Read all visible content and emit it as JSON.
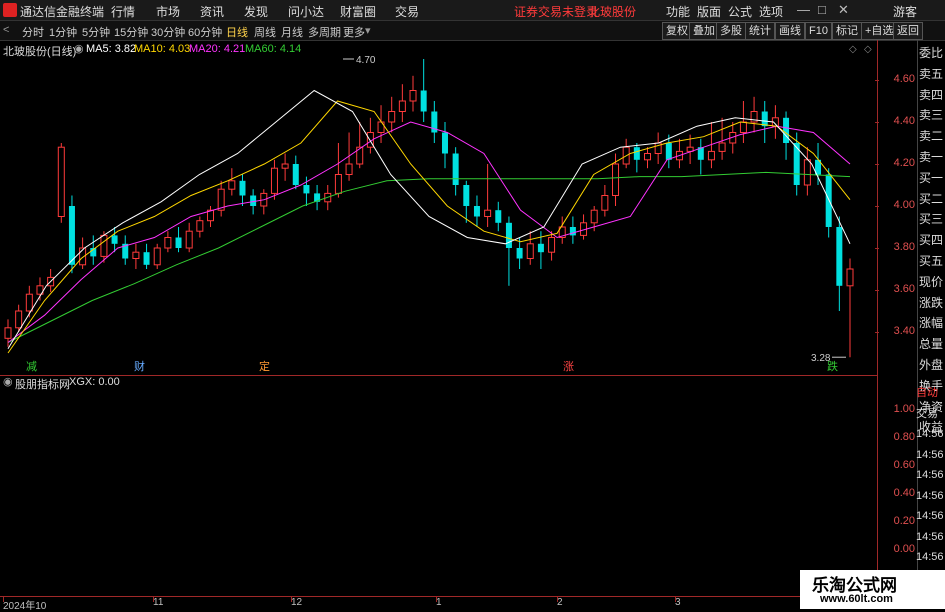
{
  "menubar": {
    "app_title": "通达信金融终端",
    "items": [
      "行情",
      "市场",
      "资讯",
      "发现",
      "问小达",
      "财富圈",
      "交易"
    ],
    "status_unlogged": "证券交易未登录",
    "status_stock": "北玻股份",
    "right_items": [
      "功能",
      "版面",
      "公式",
      "选项"
    ],
    "guest": "游客",
    "win_min": "—",
    "win_max": "□",
    "win_close": "✕"
  },
  "toolbar": {
    "periods": [
      "分时",
      "1分钟",
      "5分钟",
      "15分钟",
      "30分钟",
      "60分钟",
      "日线",
      "周线",
      "月线",
      "多周期",
      "更多"
    ],
    "active_period": "日线",
    "right_buttons": [
      "复权",
      "叠加",
      "多股",
      "统计",
      "画线",
      "F10",
      "标记",
      "+自选",
      "返回"
    ]
  },
  "chart": {
    "title": "北玻股份(日线)",
    "ma5": "MA5: 3.82",
    "ma10": "MA10: 4.03",
    "ma20": "MA20: 4.21",
    "ma60": "MA60: 4.14",
    "high_label": "4.70",
    "low_label": "3.28",
    "markers": [
      {
        "text": "减",
        "color": "#33cc33",
        "x": 31
      },
      {
        "text": "财",
        "color": "#66aaff",
        "x": 139
      },
      {
        "text": "定",
        "color": "#ff9933",
        "x": 264
      },
      {
        "text": "涨",
        "color": "#ff4444",
        "x": 568
      },
      {
        "text": "跌",
        "color": "#33cc33",
        "x": 832
      }
    ],
    "colors": {
      "up": "#ff3b3b",
      "down": "#00e0e0",
      "ma5": "#ffffff",
      "ma10": "#ffd700",
      "ma20": "#ff33ff",
      "ma60": "#33cc33",
      "axis": "#c03030"
    }
  },
  "subchart": {
    "title": "股朋指标网",
    "xgx": "XGX: 0.00"
  },
  "chart_data": {
    "type": "candlestick",
    "y_axis_ticks": [
      "4.60",
      "4.40",
      "4.20",
      "4.00",
      "3.80",
      "3.60",
      "3.40"
    ],
    "sub_axis_ticks": [
      "1.00",
      "0.80",
      "0.60",
      "0.40",
      "0.20",
      "0.00"
    ],
    "x_ticks": [
      "2024年10",
      "11",
      "12",
      "1",
      "2",
      "3"
    ],
    "ylim": [
      3.22,
      4.78
    ],
    "ma60": [
      3.35,
      3.45,
      3.55,
      3.63,
      3.72,
      3.8,
      3.9,
      4.0,
      4.07,
      4.12,
      4.13,
      4.13,
      4.13,
      4.13,
      4.13,
      4.14,
      4.14,
      4.15,
      4.16,
      4.15,
      4.14
    ],
    "ma20": [
      3.35,
      3.48,
      3.65,
      3.8,
      3.85,
      3.95,
      4.0,
      4.03,
      4.1,
      4.2,
      4.32,
      4.4,
      4.35,
      4.25,
      3.98,
      3.85,
      3.9,
      3.95,
      4.22,
      4.28,
      4.34,
      4.38,
      4.35,
      4.2
    ],
    "ma10": [
      3.3,
      3.55,
      3.75,
      3.88,
      3.95,
      4.05,
      4.12,
      4.2,
      4.3,
      4.5,
      4.45,
      4.2,
      4.0,
      3.88,
      3.83,
      3.87,
      4.15,
      4.25,
      4.3,
      4.33,
      4.4,
      4.38,
      4.25,
      4.03
    ],
    "ma5": [
      3.32,
      3.62,
      3.8,
      3.92,
      4.02,
      4.15,
      4.25,
      4.4,
      4.55,
      4.45,
      4.15,
      3.95,
      3.85,
      3.82,
      3.9,
      4.2,
      4.28,
      4.3,
      4.38,
      4.42,
      4.4,
      4.2,
      3.82
    ],
    "candles": [
      [
        3.37,
        3.42,
        3.46,
        3.33
      ],
      [
        3.42,
        3.5,
        3.53,
        3.4
      ],
      [
        3.5,
        3.58,
        3.62,
        3.47
      ],
      [
        3.58,
        3.62,
        3.66,
        3.55
      ],
      [
        3.62,
        3.66,
        3.7,
        3.59
      ],
      [
        3.95,
        4.28,
        4.3,
        3.92
      ],
      [
        4.0,
        3.72,
        4.05,
        3.68
      ],
      [
        3.72,
        3.8,
        3.85,
        3.7
      ],
      [
        3.8,
        3.76,
        3.86,
        3.72
      ],
      [
        3.76,
        3.86,
        3.88,
        3.73
      ],
      [
        3.86,
        3.82,
        3.9,
        3.78
      ],
      [
        3.82,
        3.75,
        3.86,
        3.72
      ],
      [
        3.75,
        3.78,
        3.82,
        3.7
      ],
      [
        3.78,
        3.72,
        3.82,
        3.7
      ],
      [
        3.72,
        3.8,
        3.82,
        3.7
      ],
      [
        3.8,
        3.85,
        3.88,
        3.78
      ],
      [
        3.85,
        3.8,
        3.9,
        3.78
      ],
      [
        3.8,
        3.88,
        3.92,
        3.78
      ],
      [
        3.88,
        3.93,
        3.95,
        3.85
      ],
      [
        3.93,
        3.98,
        4.0,
        3.9
      ],
      [
        3.98,
        4.08,
        4.12,
        3.95
      ],
      [
        4.08,
        4.12,
        4.18,
        4.05
      ],
      [
        4.12,
        4.05,
        4.15,
        4.0
      ],
      [
        4.05,
        4.0,
        4.08,
        3.96
      ],
      [
        4.0,
        4.06,
        4.08,
        3.96
      ],
      [
        4.06,
        4.18,
        4.22,
        4.03
      ],
      [
        4.18,
        4.2,
        4.25,
        4.12
      ],
      [
        4.2,
        4.1,
        4.24,
        4.08
      ],
      [
        4.1,
        4.06,
        4.14,
        4.0
      ],
      [
        4.06,
        4.02,
        4.1,
        3.98
      ],
      [
        4.02,
        4.06,
        4.1,
        3.98
      ],
      [
        4.06,
        4.15,
        4.3,
        4.04
      ],
      [
        4.15,
        4.2,
        4.35,
        4.12
      ],
      [
        4.2,
        4.28,
        4.4,
        4.18
      ],
      [
        4.28,
        4.35,
        4.42,
        4.25
      ],
      [
        4.35,
        4.4,
        4.48,
        4.3
      ],
      [
        4.4,
        4.45,
        4.52,
        4.35
      ],
      [
        4.45,
        4.5,
        4.58,
        4.4
      ],
      [
        4.5,
        4.55,
        4.62,
        4.45
      ],
      [
        4.55,
        4.45,
        4.7,
        4.4
      ],
      [
        4.45,
        4.35,
        4.5,
        4.3
      ],
      [
        4.35,
        4.25,
        4.4,
        4.18
      ],
      [
        4.25,
        4.1,
        4.28,
        4.05
      ],
      [
        4.1,
        4.0,
        4.12,
        3.92
      ],
      [
        4.0,
        3.95,
        4.05,
        3.9
      ],
      [
        3.95,
        3.98,
        4.2,
        3.9
      ],
      [
        3.98,
        3.92,
        4.02,
        3.88
      ],
      [
        3.92,
        3.8,
        3.95,
        3.62
      ],
      [
        3.8,
        3.75,
        3.85,
        3.7
      ],
      [
        3.75,
        3.82,
        3.88,
        3.72
      ],
      [
        3.82,
        3.78,
        3.88,
        3.7
      ],
      [
        3.78,
        3.85,
        3.88,
        3.74
      ],
      [
        3.85,
        3.9,
        3.95,
        3.82
      ],
      [
        3.9,
        3.86,
        3.95,
        3.82
      ],
      [
        3.86,
        3.92,
        3.96,
        3.84
      ],
      [
        3.92,
        3.98,
        4.0,
        3.88
      ],
      [
        3.98,
        4.05,
        4.1,
        3.95
      ],
      [
        4.05,
        4.2,
        4.25,
        4.0
      ],
      [
        4.2,
        4.28,
        4.32,
        4.18
      ],
      [
        4.28,
        4.22,
        4.3,
        4.16
      ],
      [
        4.22,
        4.25,
        4.28,
        4.18
      ],
      [
        4.25,
        4.3,
        4.35,
        4.2
      ],
      [
        4.3,
        4.22,
        4.34,
        4.18
      ],
      [
        4.22,
        4.26,
        4.32,
        4.18
      ],
      [
        4.26,
        4.28,
        4.34,
        4.2
      ],
      [
        4.28,
        4.22,
        4.32,
        4.15
      ],
      [
        4.22,
        4.26,
        4.4,
        4.18
      ],
      [
        4.26,
        4.3,
        4.42,
        4.22
      ],
      [
        4.3,
        4.35,
        4.4,
        4.25
      ],
      [
        4.35,
        4.4,
        4.5,
        4.3
      ],
      [
        4.4,
        4.45,
        4.52,
        4.35
      ],
      [
        4.45,
        4.38,
        4.5,
        4.3
      ],
      [
        4.38,
        4.42,
        4.48,
        4.32
      ],
      [
        4.42,
        4.3,
        4.45,
        4.22
      ],
      [
        4.3,
        4.1,
        4.35,
        4.05
      ],
      [
        4.1,
        4.22,
        4.28,
        4.05
      ],
      [
        4.22,
        4.15,
        4.3,
        4.1
      ],
      [
        4.15,
        3.9,
        4.18,
        3.85
      ],
      [
        3.9,
        3.62,
        3.95,
        3.5
      ],
      [
        3.62,
        3.7,
        3.75,
        3.28
      ]
    ]
  },
  "right_panel": {
    "labels": [
      "委比",
      "卖五",
      "卖四",
      "卖三",
      "卖二",
      "卖一",
      "买一",
      "买二",
      "买三",
      "买四",
      "买五",
      "现价",
      "涨跌",
      "涨幅",
      "总量",
      "外盘",
      "换手",
      "净资",
      "收益"
    ],
    "sub_labels": [
      "自动",
      "交易",
      "14:56",
      "14:56",
      "14:56",
      "14:56",
      "14:56",
      "14:56",
      "14:56",
      "14:56"
    ]
  },
  "watermark": {
    "line1": "乐淘公式网",
    "line2": "www.60lt.com"
  }
}
